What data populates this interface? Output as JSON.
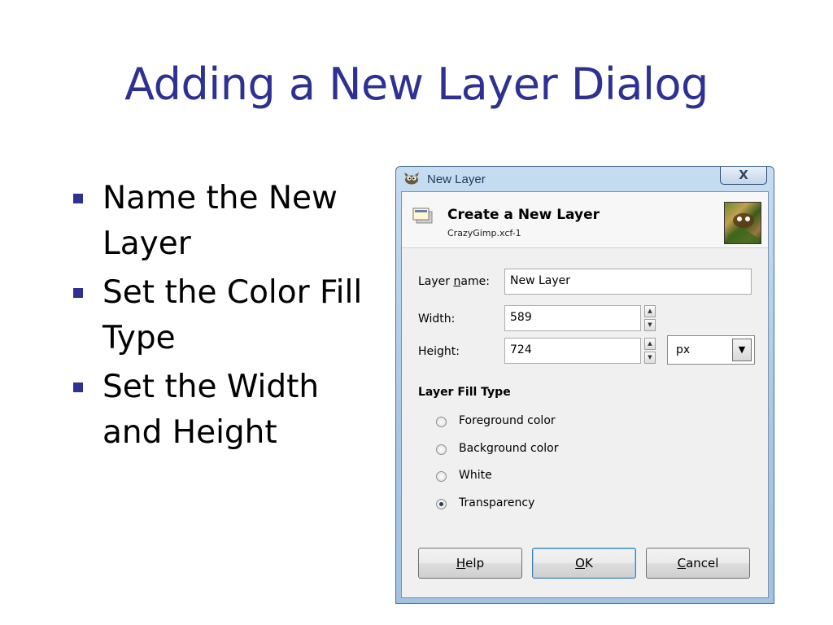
{
  "slide": {
    "title": "Adding a New Layer Dialog",
    "bullets": [
      "Name the New Layer",
      "Set the Color Fill Type",
      "Set the Width and Height"
    ]
  },
  "dialog": {
    "window_title": "New Layer",
    "close_glyph": "X",
    "header_title": "Create a New Layer",
    "header_subtitle": "CrazyGimp.xcf-1",
    "layer_name": {
      "label_pre": "Layer ",
      "label_mnemonic": "n",
      "label_post": "ame:",
      "value": "New Layer"
    },
    "width": {
      "label": "Width:",
      "value": "589"
    },
    "height": {
      "label": "Height:",
      "value": "724"
    },
    "unit": {
      "value": "px"
    },
    "fill_type": {
      "heading": "Layer Fill Type",
      "options": [
        {
          "label": "Foreground color",
          "selected": false
        },
        {
          "label": "Background color",
          "selected": false
        },
        {
          "label": "White",
          "selected": false
        },
        {
          "label": "Transparency",
          "selected": true
        }
      ]
    },
    "buttons": {
      "help": {
        "mnemonic": "H",
        "rest": "elp"
      },
      "ok": {
        "mnemonic": "O",
        "rest": "K"
      },
      "cancel": {
        "mnemonic": "C",
        "rest": "ancel"
      }
    },
    "icons": [
      "gimp-app-icon",
      "layer-icon",
      "image-thumbnail",
      "close-icon",
      "spin-up-icon",
      "spin-down-icon",
      "dropdown-arrow-icon"
    ]
  }
}
